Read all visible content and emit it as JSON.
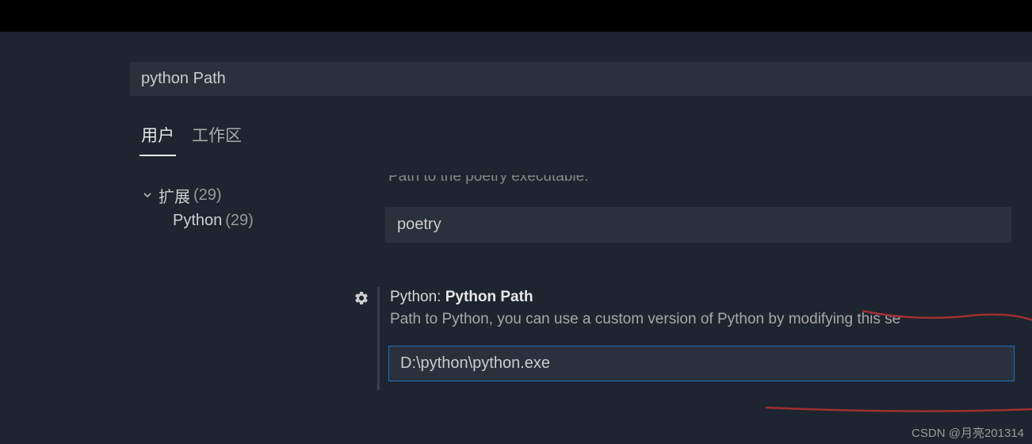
{
  "search": {
    "value": "python Path"
  },
  "tabs": {
    "user": "用户",
    "workspace": "工作区"
  },
  "sidebar": {
    "extensions": {
      "label": "扩展",
      "count": "(29)"
    },
    "python": {
      "label": "Python",
      "count": "(29)"
    }
  },
  "settings": {
    "poetry": {
      "desc_cut": "Path to the poetry executable.",
      "value": "poetry"
    },
    "pythonPath": {
      "prefix": "Python:",
      "title": "Python Path",
      "desc": "Path to Python, you can use a custom version of Python by modifying this se",
      "value": "D:\\python\\python.exe"
    }
  },
  "watermark": "CSDN @月亮201314"
}
